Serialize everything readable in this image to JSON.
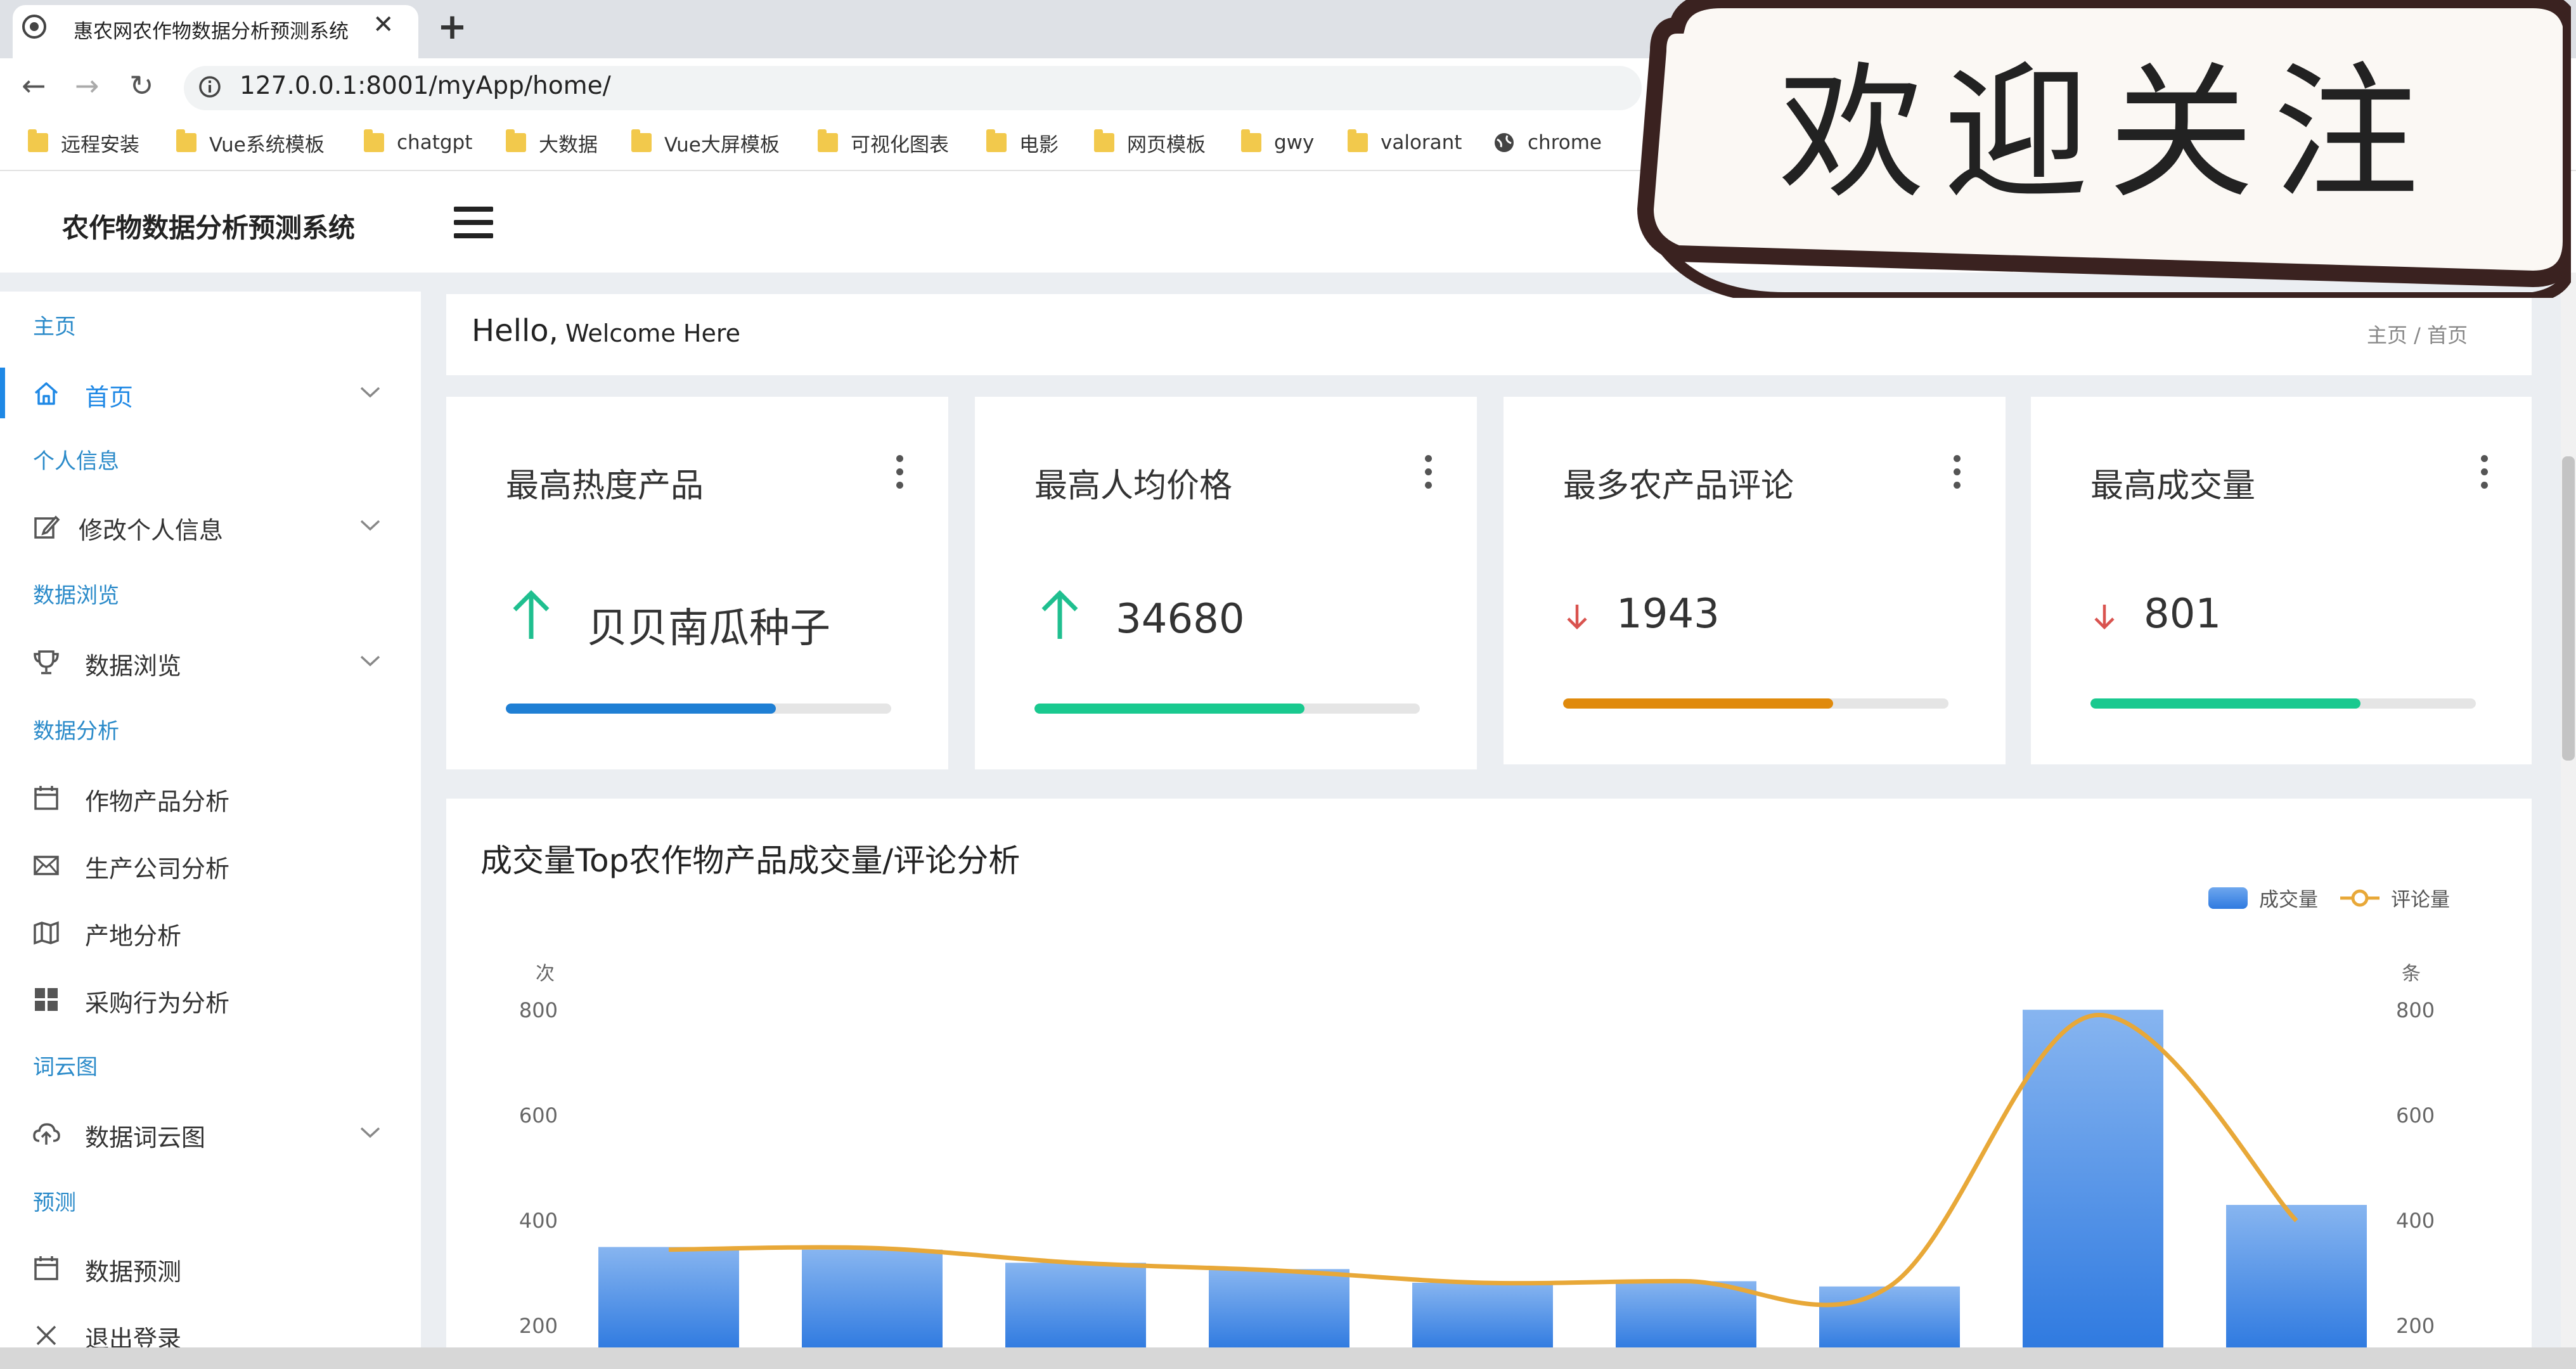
{
  "browser": {
    "tab_title": "惠农网农作物数据分析预测系统",
    "tab_close": "✕",
    "new_tab": "+",
    "url": "127.0.0.1:8001/myApp/home/",
    "back": "←",
    "forward": "→",
    "reload": "↻",
    "bookmarks": [
      "远程安装",
      "Vue系统模板",
      "chatgpt",
      "大数据",
      "Vue大屏模板",
      "可视化图表",
      "电影",
      "网页模板",
      "gwy",
      "valorant",
      "chrome"
    ]
  },
  "header": {
    "brand": "农作物数据分析预测系统"
  },
  "watermark": {
    "text": "欢迎关注"
  },
  "sidebar": {
    "sections": [
      {
        "title": "主页",
        "items": [
          {
            "label": "首页",
            "icon": "home-icon",
            "expandable": true,
            "active": true
          }
        ]
      },
      {
        "title": "个人信息",
        "items": [
          {
            "label": "修改个人信息",
            "icon": "edit-icon",
            "expandable": true
          }
        ]
      },
      {
        "title": "数据浏览",
        "items": [
          {
            "label": "数据浏览",
            "icon": "trophy-icon",
            "expandable": true
          }
        ]
      },
      {
        "title": "数据分析",
        "items": [
          {
            "label": "作物产品分析",
            "icon": "calendar-icon"
          },
          {
            "label": "生产公司分析",
            "icon": "mail-icon"
          },
          {
            "label": "产地分析",
            "icon": "map-icon"
          },
          {
            "label": "采购行为分析",
            "icon": "grid-icon"
          }
        ]
      },
      {
        "title": "词云图",
        "items": [
          {
            "label": "数据词云图",
            "icon": "cloud-upload-icon",
            "expandable": true
          }
        ]
      },
      {
        "title": "预测",
        "items": [
          {
            "label": "数据预测",
            "icon": "calendar-icon"
          },
          {
            "label": "退出登录",
            "icon": "close-icon"
          }
        ]
      }
    ]
  },
  "hello": {
    "big": "Hello,",
    "small": "Welcome Here",
    "breadcrumb": "主页  /  首页"
  },
  "cards": [
    {
      "title": "最高热度产品",
      "value": "贝贝南瓜种子",
      "trend": "up",
      "progress": 0.7,
      "color": "#1f7fd4"
    },
    {
      "title": "最高人均价格",
      "value": "34680",
      "trend": "up",
      "progress": 0.7,
      "color": "#19c98f"
    },
    {
      "title": "最多农产品评论",
      "value": "1943",
      "trend": "down",
      "progress": 0.7,
      "color": "#e08a0c"
    },
    {
      "title": "最高成交量",
      "value": "801",
      "trend": "down",
      "progress": 0.7,
      "color": "#19c98f"
    }
  ],
  "colors": {
    "up_arrow": "#1fbf8f",
    "down_arrow": "#d9534f"
  },
  "chart_data": {
    "type": "bar",
    "title": "成交量Top农作物产品成交量/评论分析",
    "series": [
      {
        "name": "成交量",
        "type": "bar",
        "values": [
          350,
          345,
          320,
          308,
          282,
          285,
          275,
          801,
          430
        ]
      },
      {
        "name": "评论量",
        "type": "line",
        "values": [
          345,
          348,
          320,
          305,
          282,
          285,
          275,
          790,
          400
        ]
      }
    ],
    "y_left": {
      "unit": "次",
      "ticks": [
        200,
        400,
        600,
        800
      ]
    },
    "y_right": {
      "unit": "条",
      "ticks": [
        200,
        400,
        600,
        800
      ]
    },
    "legend_position": "top-right",
    "colors": {
      "bar": "#4a8fe6",
      "line": "#e8a838"
    }
  }
}
